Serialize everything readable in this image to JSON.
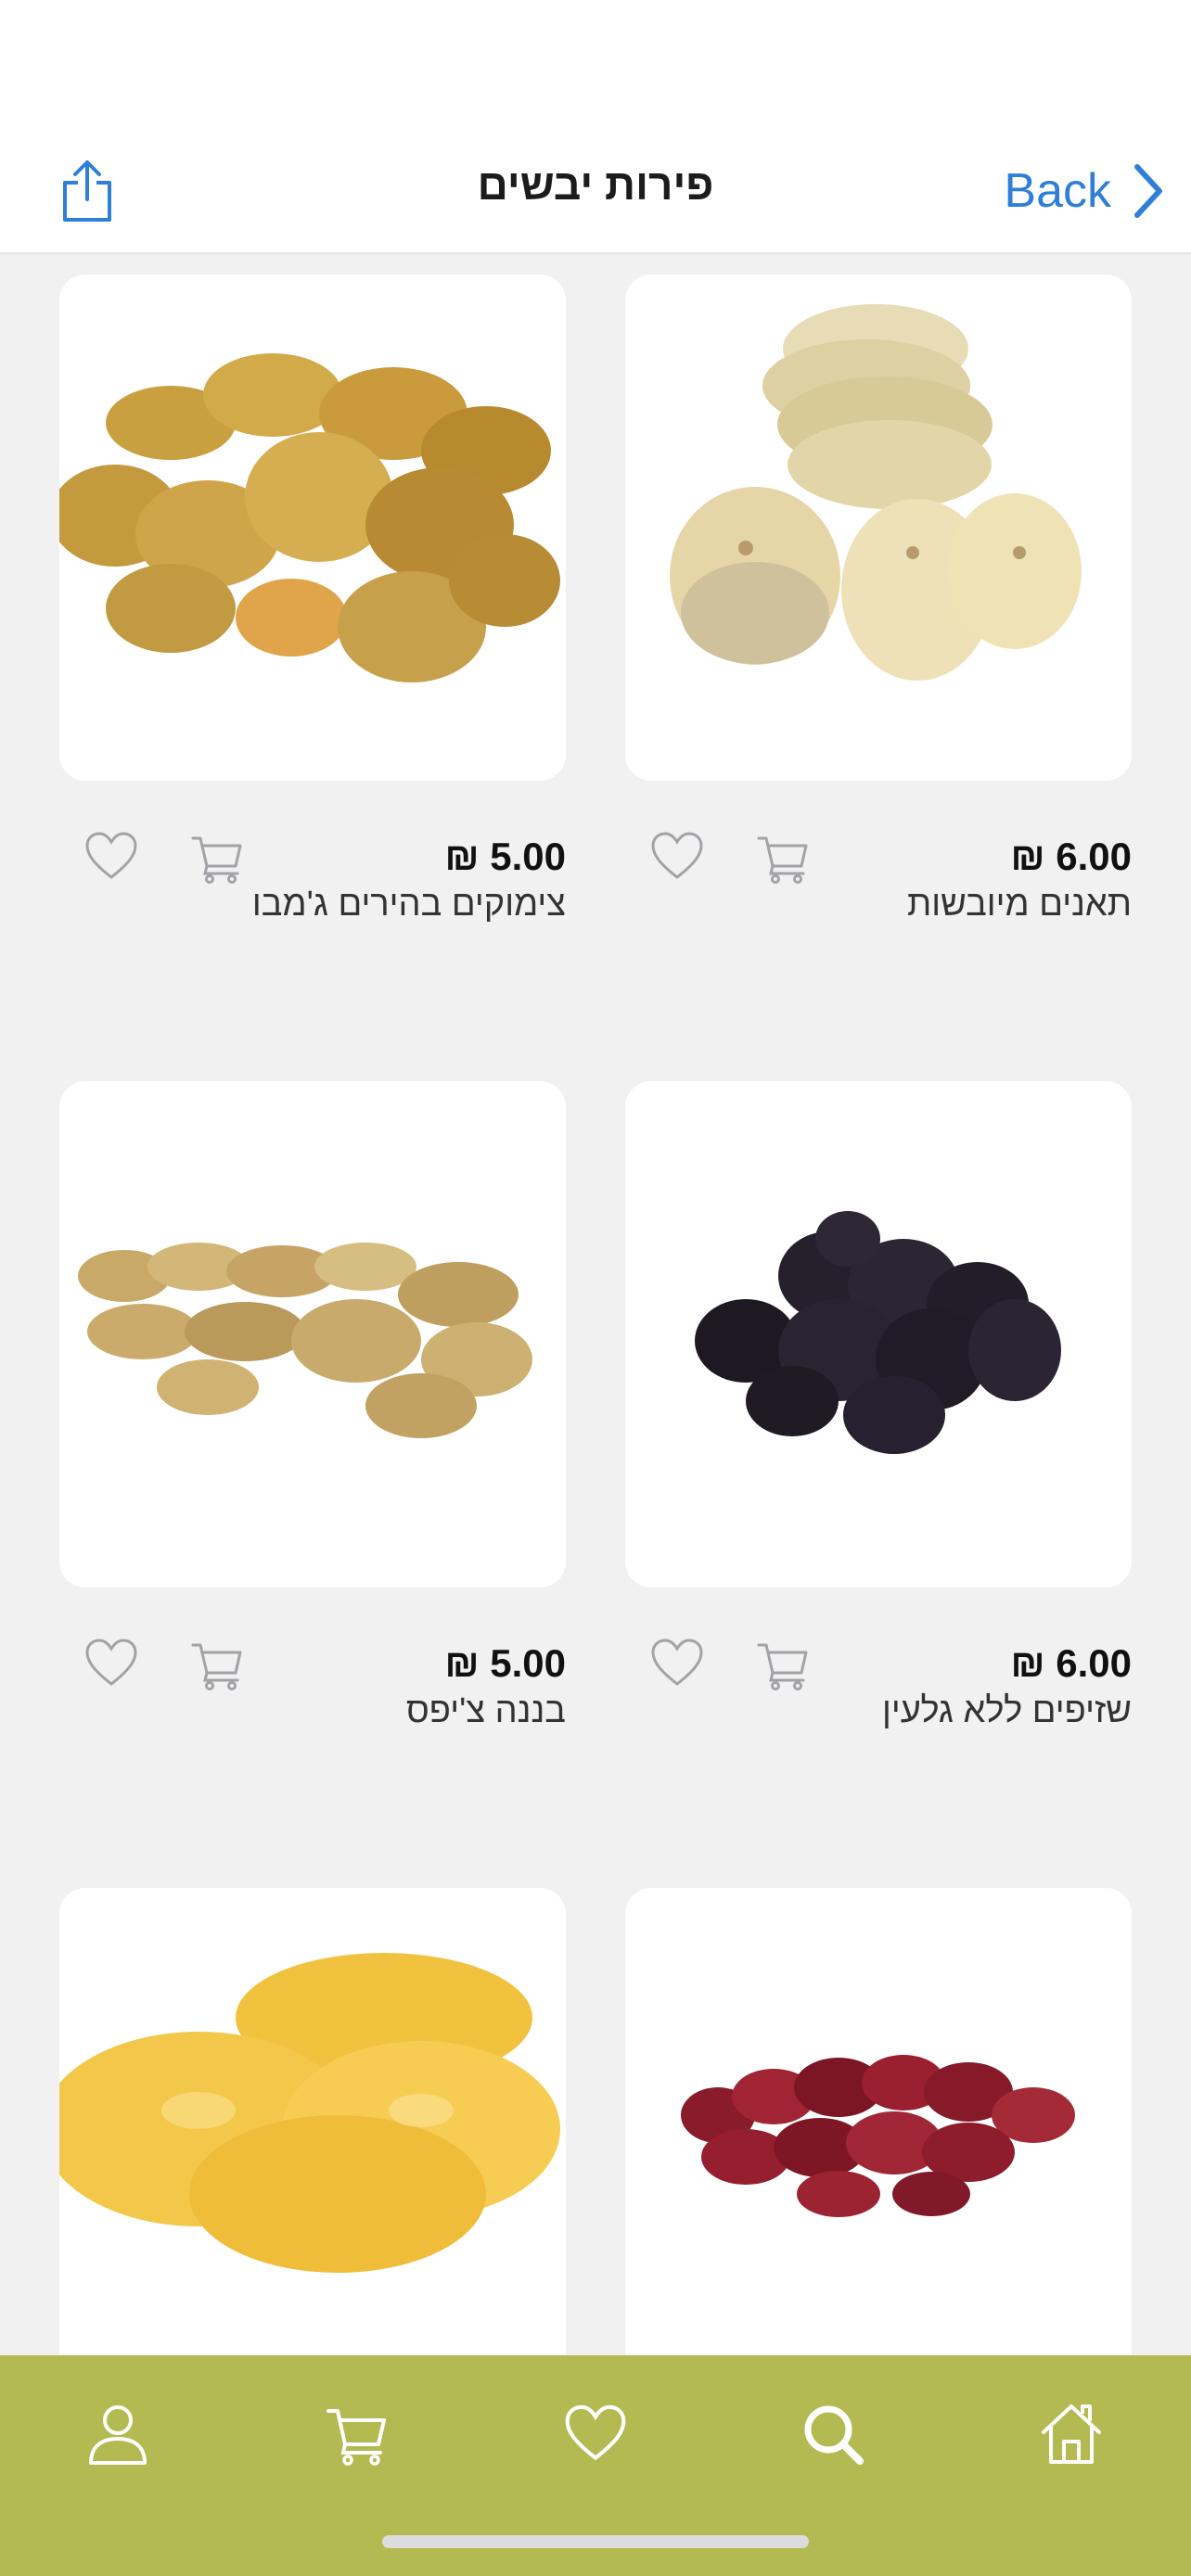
{
  "header": {
    "title": "פירות יבשים",
    "back_label": "Back",
    "share_icon": "share-icon",
    "back_icon": "chevron-left-icon"
  },
  "products": [
    {
      "name": "תאנים מיובשות",
      "price": "₪ 6.00",
      "image": "dried-figs"
    },
    {
      "name": "צימוקים בהירים ג'מבו",
      "price": "₪ 5.00",
      "image": "golden-raisins"
    },
    {
      "name": "שזיפים ללא גלעין",
      "price": "₪ 6.00",
      "image": "pitted-prunes"
    },
    {
      "name": "בננה צ'יפס",
      "price": "₪ 5.00",
      "image": "banana-chips"
    },
    {
      "name": "",
      "price": "",
      "image": "dried-cranberries"
    },
    {
      "name": "",
      "price": "",
      "image": "dried-pineapple"
    }
  ],
  "tabbar": {
    "items": [
      "home-icon",
      "search-icon",
      "heart-icon",
      "cart-icon",
      "user-icon"
    ],
    "background": "#b3ba52"
  },
  "colors": {
    "accent": "#2f7fd8",
    "tabbar": "#b3ba52",
    "background": "#f1f1f2"
  }
}
